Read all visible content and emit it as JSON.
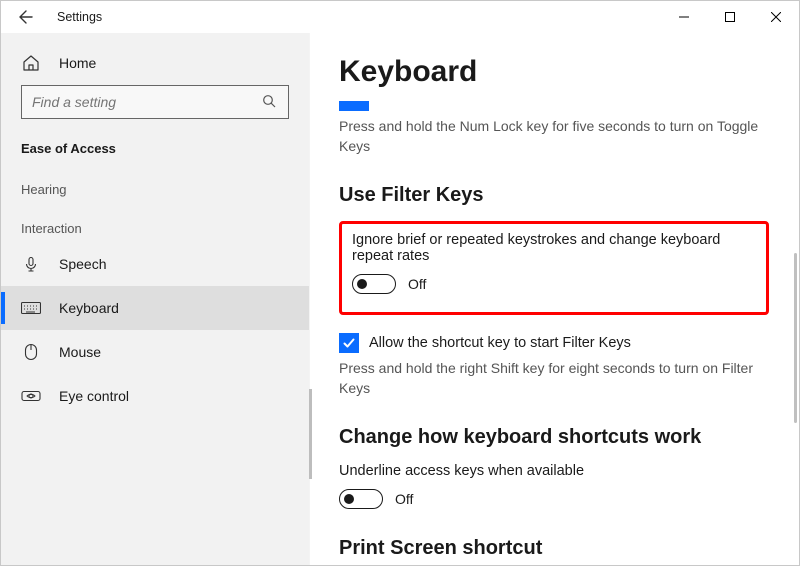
{
  "titlebar": {
    "title": "Settings"
  },
  "sidebar": {
    "home_label": "Home",
    "search_placeholder": "Find a setting",
    "group_title": "Ease of Access",
    "sub_hearing": "Hearing",
    "sub_interaction": "Interaction",
    "items": {
      "speech": "Speech",
      "keyboard": "Keyboard",
      "mouse": "Mouse",
      "eye": "Eye control"
    }
  },
  "content": {
    "page_title": "Keyboard",
    "toggle_keys_desc": "Press and hold the Num Lock key for five seconds to turn on Toggle Keys",
    "filter": {
      "heading": "Use Filter Keys",
      "label": "Ignore brief or repeated keystrokes and change keyboard repeat rates",
      "state": "Off",
      "checkbox_label": "Allow the shortcut key to start Filter Keys",
      "shortcut_desc": "Press and hold the right Shift key for eight seconds to turn on Filter Keys"
    },
    "shortcuts": {
      "heading": "Change how keyboard shortcuts work",
      "label": "Underline access keys when available",
      "state": "Off"
    },
    "printscreen": {
      "heading": "Print Screen shortcut"
    }
  }
}
